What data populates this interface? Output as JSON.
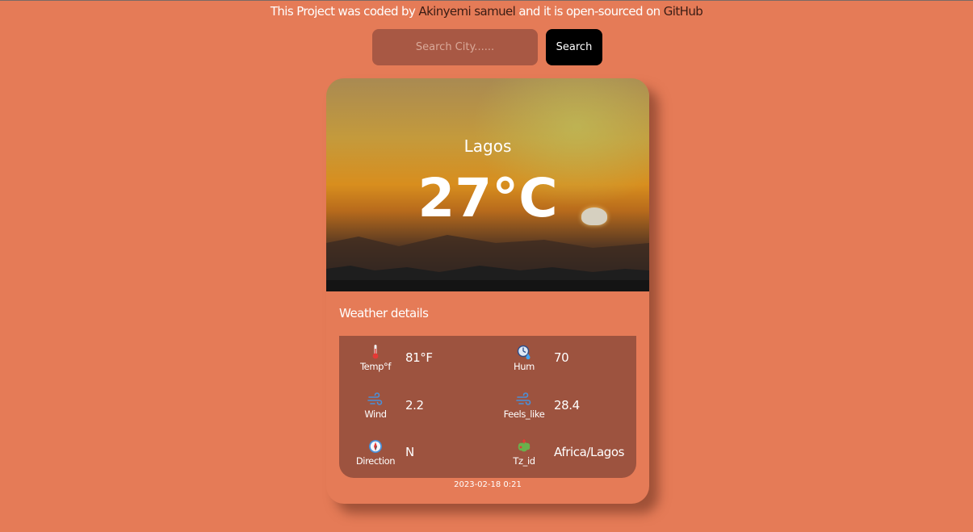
{
  "credit": {
    "prefix": "This Project was coded by",
    "author": "Akinyemi samuel",
    "middle": "and it is open-sourced on",
    "repo": "GitHub"
  },
  "search": {
    "placeholder": "Search City......",
    "button_label": "Search"
  },
  "weather": {
    "city": "Lagos",
    "temperature": "27°C",
    "details_title": "Weather details",
    "details": [
      {
        "icon": "thermometer-icon",
        "label": "Temp°f",
        "value": "81°F"
      },
      {
        "icon": "humidity-icon",
        "label": "Hum",
        "value": "70"
      },
      {
        "icon": "wind-icon",
        "label": "Wind",
        "value": "2.2"
      },
      {
        "icon": "wind-icon",
        "label": "Feels_like",
        "value": "28.4"
      },
      {
        "icon": "compass-icon",
        "label": "Direction",
        "value": "N"
      },
      {
        "icon": "globe-icon",
        "label": "Tz_id",
        "value": "Africa/Lagos"
      }
    ],
    "datetime": "2023-02-18 0:21"
  },
  "colors": {
    "background": "#e57b57",
    "details_panel": "#9d533f",
    "search_input": "#a85844",
    "search_button": "#000000",
    "link_text": "#3a1c14"
  }
}
